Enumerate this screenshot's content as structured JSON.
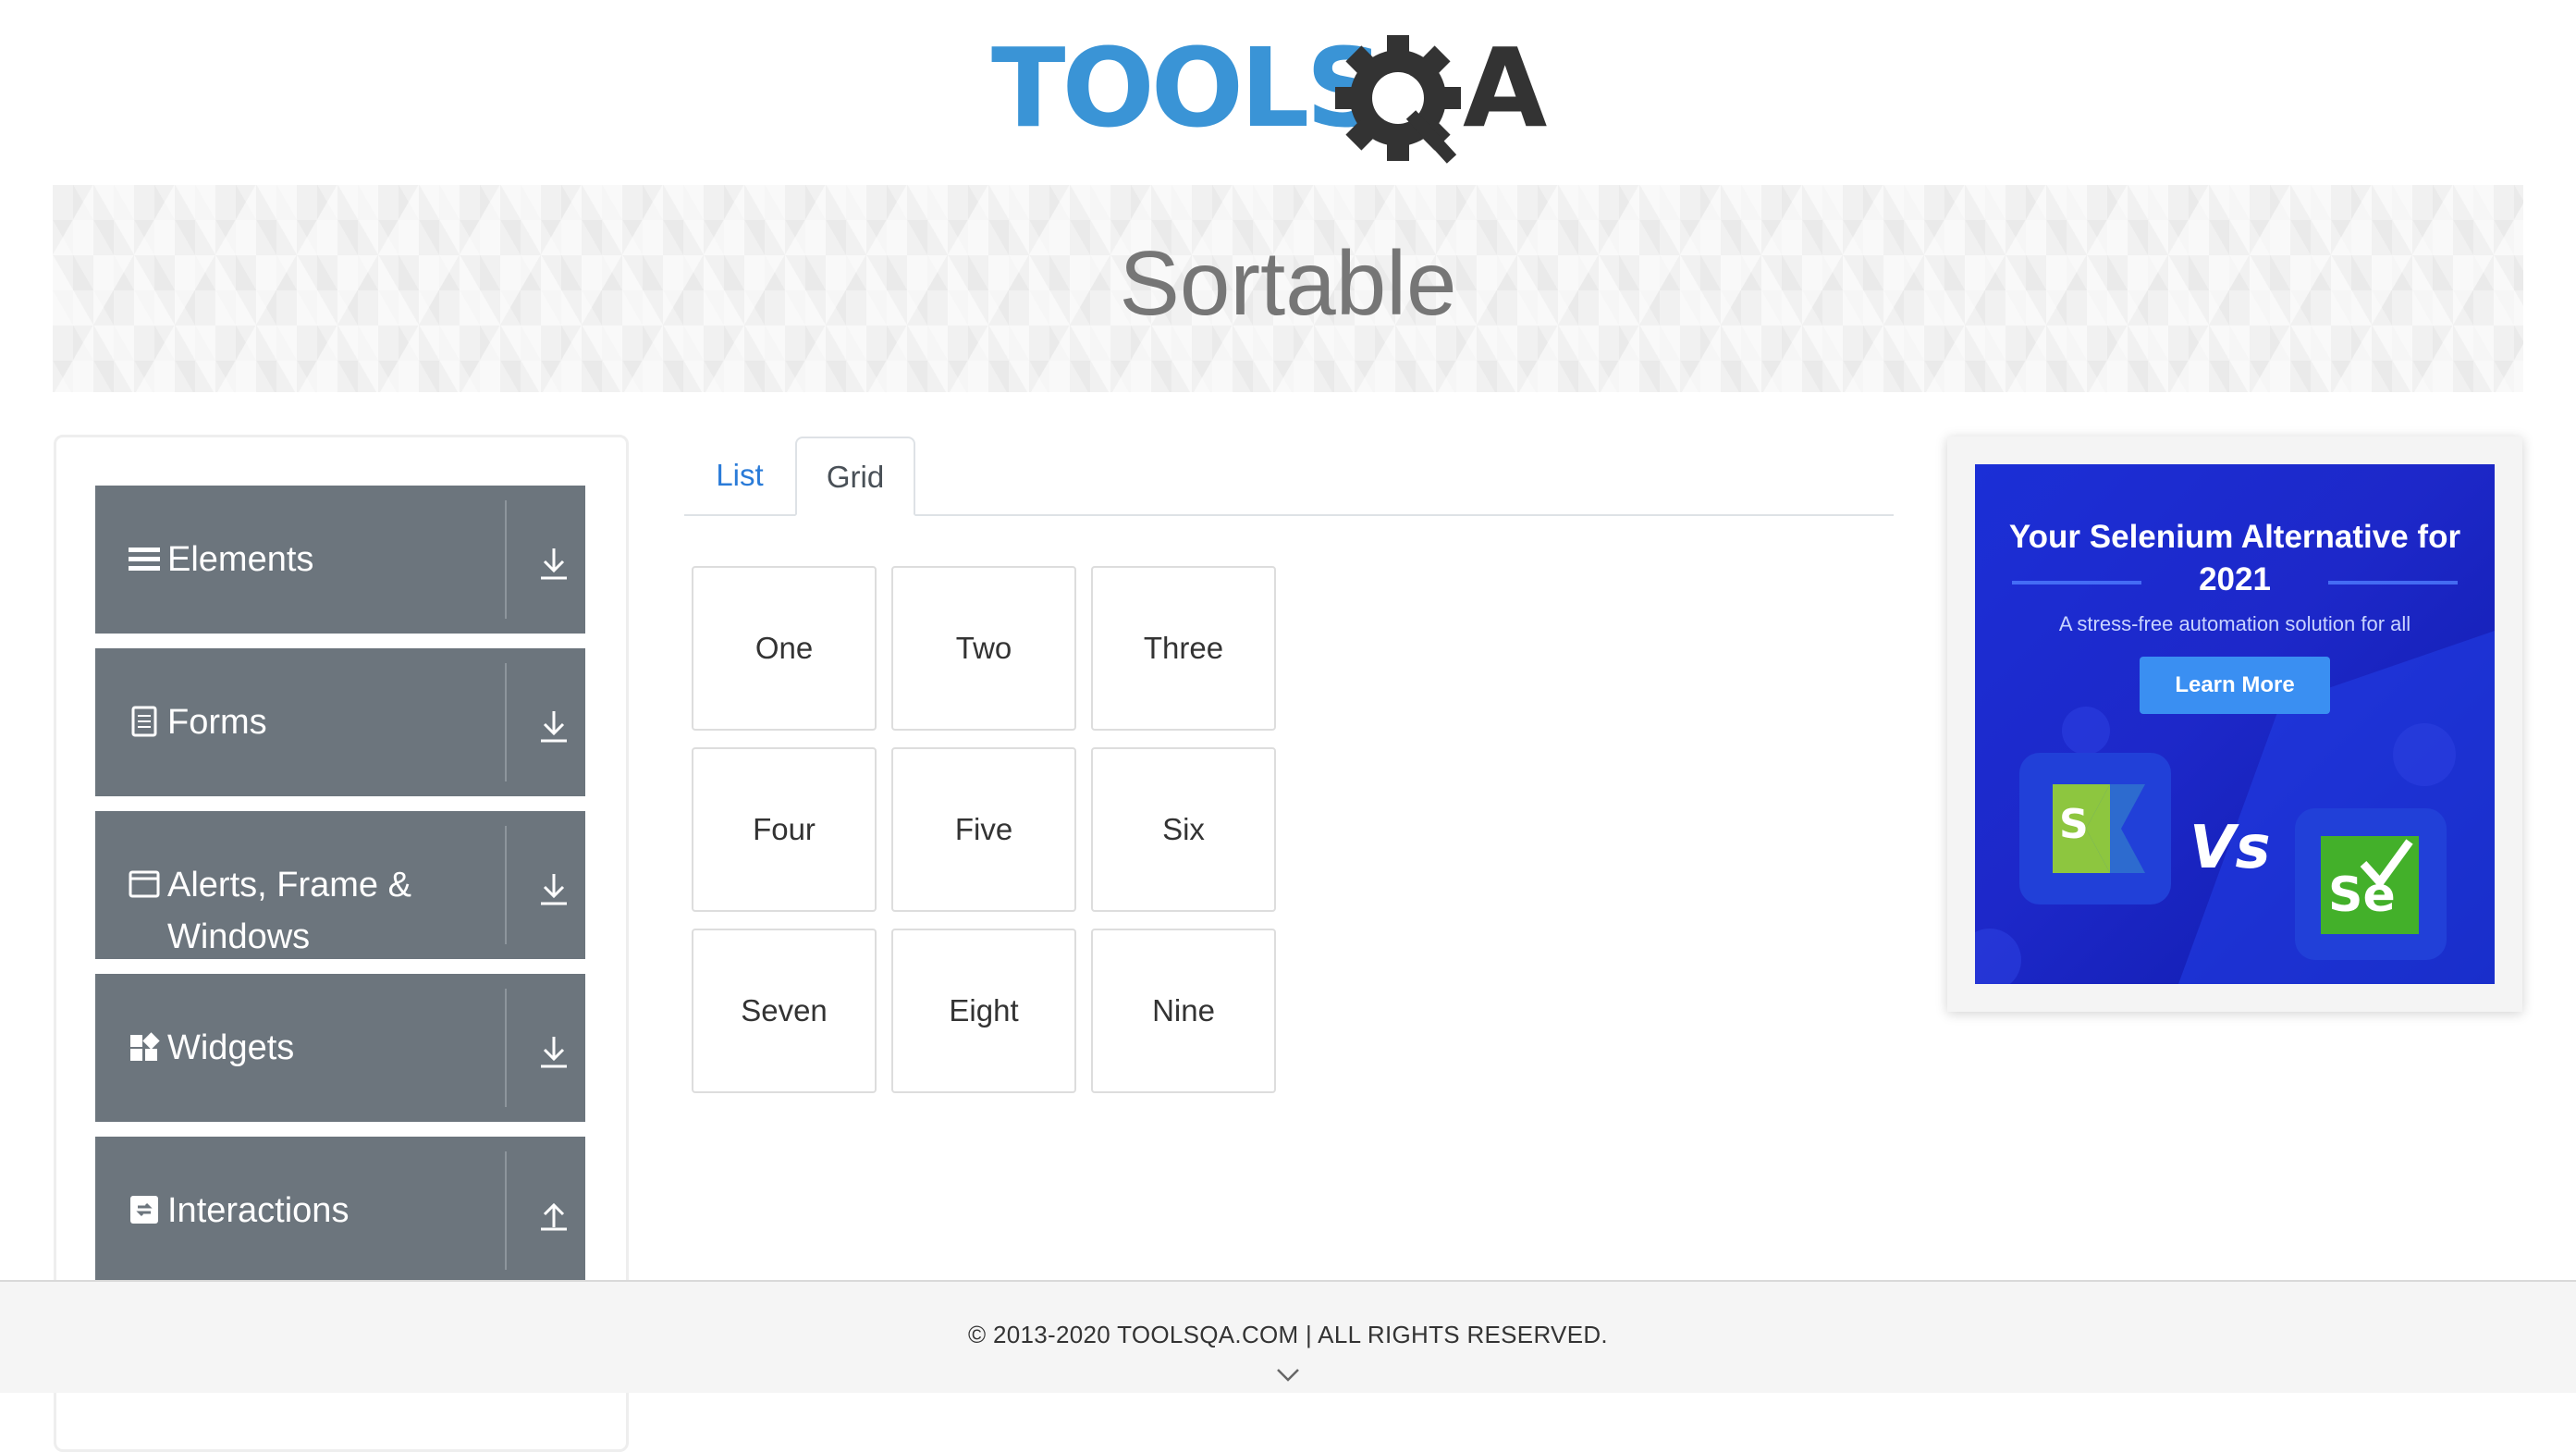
{
  "header": {
    "logo_text": "TOOLSQA"
  },
  "banner": {
    "title": "Sortable"
  },
  "sidebar": {
    "groups": [
      {
        "label": "Elements",
        "icon": "hamburger-icon",
        "arrow": "arrow-down-icon"
      },
      {
        "label": "Forms",
        "icon": "document-icon",
        "arrow": "arrow-down-icon"
      },
      {
        "label": "Alerts, Frame & Windows",
        "icon": "window-icon",
        "arrow": "arrow-down-icon"
      },
      {
        "label": "Widgets",
        "icon": "widgets-icon",
        "arrow": "arrow-down-icon"
      },
      {
        "label": "Interactions",
        "icon": "interactions-icon",
        "arrow": "arrow-up-icon"
      }
    ]
  },
  "tabs": {
    "list_label": "List",
    "grid_label": "Grid",
    "active": "Grid"
  },
  "grid": {
    "items": [
      "One",
      "Two",
      "Three",
      "Four",
      "Five",
      "Six",
      "Seven",
      "Eight",
      "Nine"
    ]
  },
  "ad": {
    "title": "Your Selenium Alternative for 2021",
    "subtitle": "A stress-free automation solution for all",
    "button": "Learn More",
    "vs": "Vs",
    "left_badge": "S",
    "right_badge": "Se"
  },
  "footer": {
    "text": "© 2013-2020 TOOLSQA.COM | ALL RIGHTS RESERVED."
  },
  "colors": {
    "sidebar_bg": "#6c757d",
    "link_blue": "#2a7bd8",
    "logo_blue": "#3a94d6",
    "logo_dark": "#333333",
    "ad_blue": "#1b2fd6"
  }
}
